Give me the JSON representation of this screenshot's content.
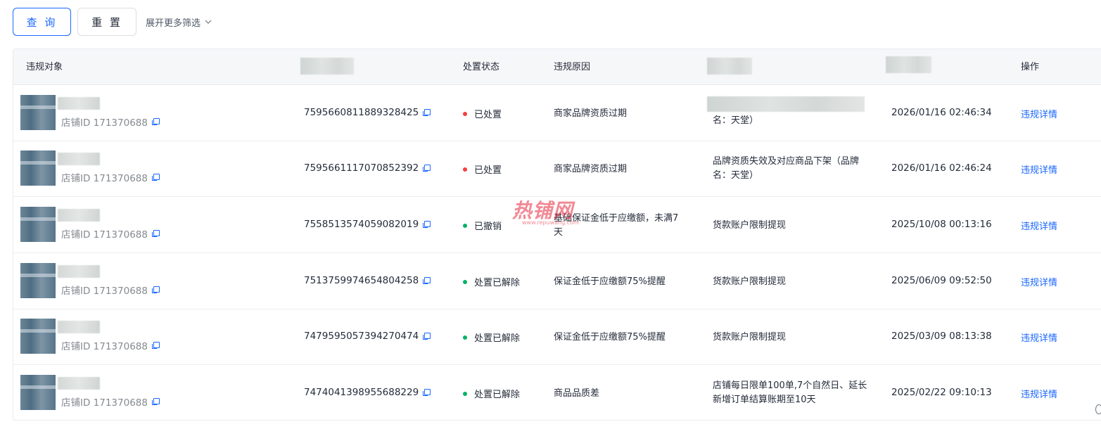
{
  "toolbar": {
    "query_label": "查 询",
    "reset_label": "重 置",
    "expand_label": "展开更多筛选",
    "expand_icon": "chevron-down-icon"
  },
  "table": {
    "headers": {
      "target": "违规对象",
      "col2": "",
      "status": "处置状态",
      "reason": "违规原因",
      "col5": "",
      "col6": "",
      "action": "操作"
    },
    "rows": [
      {
        "shop_id": "店铺ID 171370688",
        "ticket_id": "7595660811889328425",
        "status": "已处置",
        "status_color": "#f53f3f",
        "reason": "商家品牌资质过期",
        "measure": "名：天堂）",
        "time": "2026/01/16 02:46:34",
        "action": "违规详情"
      },
      {
        "shop_id": "店铺ID 171370688",
        "ticket_id": "7595661117070852392",
        "status": "已处置",
        "status_color": "#f53f3f",
        "reason": "商家品牌资质过期",
        "measure": "品牌资质失效及对应商品下架（品牌名：天堂）",
        "time": "2026/01/16 02:46:24",
        "action": "违规详情"
      },
      {
        "shop_id": "店铺ID 171370688",
        "ticket_id": "7558513574059082019",
        "status": "已撤销",
        "status_color": "#00b365",
        "reason": "基础保证金低于应缴额，未满7天",
        "measure": "货款账户限制提现",
        "time": "2025/10/08 00:13:16",
        "action": "违规详情"
      },
      {
        "shop_id": "店铺ID 171370688",
        "ticket_id": "7513759974654804258",
        "status": "处置已解除",
        "status_color": "#00b365",
        "reason": "保证金低于应缴额75%提醒",
        "measure": "货款账户限制提现",
        "time": "2025/06/09 09:52:50",
        "action": "违规详情"
      },
      {
        "shop_id": "店铺ID 171370688",
        "ticket_id": "7479595057394270474",
        "status": "处置已解除",
        "status_color": "#00b365",
        "reason": "保证金低于应缴额75%提醒",
        "measure": "货款账户限制提现",
        "time": "2025/03/09 08:13:38",
        "action": "违规详情"
      },
      {
        "shop_id": "店铺ID 171370688",
        "ticket_id": "7474041398955688229",
        "status": "处置已解除",
        "status_color": "#00b365",
        "reason": "商品品质差",
        "measure": "店铺每日限单100单,7个自然日、延长新增订单结算账期至10天",
        "time": "2025/02/22 09:10:13",
        "action": "违规详情"
      }
    ]
  },
  "watermark": {
    "text": "热铺网",
    "sub": "www.repuwang.com"
  },
  "colors": {
    "accent": "#1966ff",
    "status_red": "#f53f3f",
    "status_green": "#00b365"
  }
}
